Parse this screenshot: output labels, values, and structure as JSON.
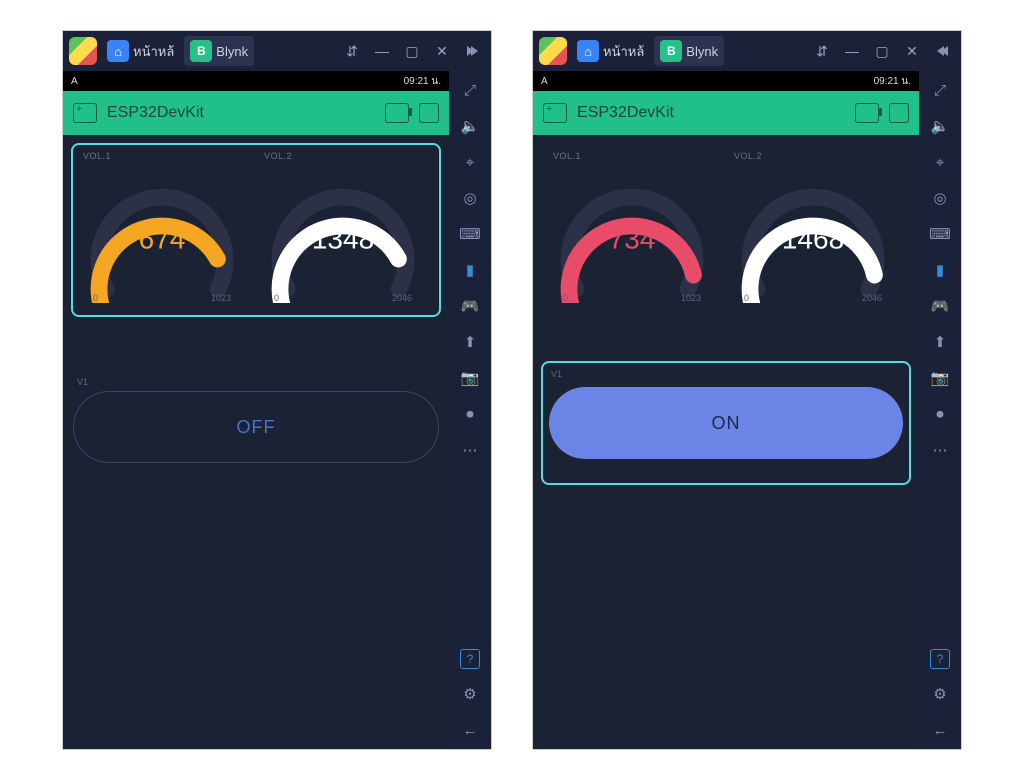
{
  "windows": [
    {
      "tabs": {
        "home": "หน้าหล้",
        "blynk": "Blynk",
        "blynk_icon_letter": "B"
      },
      "statusbar": {
        "left": "A",
        "right": "09:21 น."
      },
      "app": {
        "title": "ESP32DevKit",
        "gauges": {
          "g1": {
            "label": "VOL.1",
            "value": "674",
            "min": "0",
            "max": "1023",
            "color": "#f5a623",
            "fraction": 0.66
          },
          "g2": {
            "label": "VOL.2",
            "value": "1348",
            "min": "0",
            "max": "2046",
            "color": "#ffffff",
            "fraction": 0.66
          }
        },
        "v1_label": "V1",
        "button": {
          "state": "off",
          "label": "OFF",
          "selected": false
        }
      },
      "collapse_dir": "right"
    },
    {
      "tabs": {
        "home": "หน้าหล้",
        "blynk": "Blynk",
        "blynk_icon_letter": "B"
      },
      "statusbar": {
        "left": "A",
        "right": "09:21 น."
      },
      "app": {
        "title": "ESP32DevKit",
        "gauges": {
          "g1": {
            "label": "VOL.1",
            "value": "734",
            "min": "0",
            "max": "1023",
            "color": "#e84c68",
            "fraction": 0.72
          },
          "g2": {
            "label": "VOL.2",
            "value": "1468",
            "min": "0",
            "max": "2046",
            "color": "#ffffff",
            "fraction": 0.72
          }
        },
        "v1_label": "V1",
        "button": {
          "state": "on",
          "label": "ON",
          "selected": true
        }
      },
      "collapse_dir": "left"
    }
  ],
  "chart_data": [
    {
      "type": "gauge",
      "title": "VOL.1",
      "value": 674,
      "min": 0,
      "max": 1023,
      "color": "#f5a623"
    },
    {
      "type": "gauge",
      "title": "VOL.2",
      "value": 1348,
      "min": 0,
      "max": 2046,
      "color": "#ffffff"
    },
    {
      "type": "gauge",
      "title": "VOL.1",
      "value": 734,
      "min": 0,
      "max": 1023,
      "color": "#e84c68"
    },
    {
      "type": "gauge",
      "title": "VOL.2",
      "value": 1468,
      "min": 0,
      "max": 2046,
      "color": "#ffffff"
    }
  ]
}
